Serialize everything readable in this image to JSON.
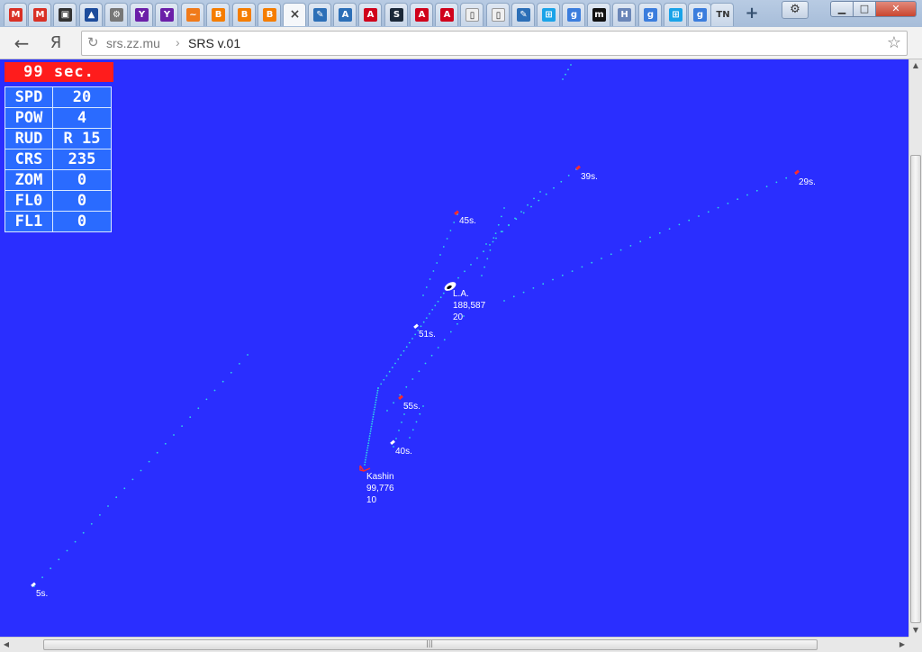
{
  "browser": {
    "tabs": [
      {
        "icon": "gmail-icon",
        "glyph": "M",
        "color": "#d93025"
      },
      {
        "icon": "gmail-icon",
        "glyph": "M",
        "color": "#d93025"
      },
      {
        "icon": "photo-icon",
        "glyph": "▣",
        "color": "#333333"
      },
      {
        "icon": "triangle-logo-icon",
        "glyph": "▲",
        "color": "#1d4c9c"
      },
      {
        "icon": "gear-wrench-icon",
        "glyph": "⚙",
        "color": "#777777"
      },
      {
        "icon": "yahoo-icon",
        "glyph": "Y",
        "color": "#6b1fa8"
      },
      {
        "icon": "yahoo-icon",
        "glyph": "Y",
        "color": "#6b1fa8"
      },
      {
        "icon": "chart-icon",
        "glyph": "~",
        "color": "#f07a1a"
      },
      {
        "icon": "blogger-icon",
        "glyph": "B",
        "color": "#f57d00"
      },
      {
        "icon": "blogger-icon",
        "glyph": "B",
        "color": "#f57d00"
      },
      {
        "icon": "blogger-icon",
        "glyph": "B",
        "color": "#f57d00"
      },
      {
        "icon": "close-icon",
        "glyph": "×",
        "color": "#f5f7fa",
        "active": true
      },
      {
        "icon": "pen-icon",
        "glyph": "✎",
        "color": "#2c6fb7"
      },
      {
        "icon": "translate-icon",
        "glyph": "A",
        "color": "#2c6fb7"
      },
      {
        "icon": "adobe-icon",
        "glyph": "A",
        "color": "#d0021b"
      },
      {
        "icon": "steam-icon",
        "glyph": "S",
        "color": "#1b2838"
      },
      {
        "icon": "adobe-icon",
        "glyph": "A",
        "color": "#d0021b"
      },
      {
        "icon": "adobe-icon",
        "glyph": "A",
        "color": "#d0021b"
      },
      {
        "icon": "document-icon",
        "glyph": "▯",
        "color": "#f0f0f0"
      },
      {
        "icon": "document-icon",
        "glyph": "▯",
        "color": "#f0f0f0"
      },
      {
        "icon": "pen-icon",
        "glyph": "✎",
        "color": "#2c6fb7"
      },
      {
        "icon": "windows-icon",
        "glyph": "⊞",
        "color": "#1aa3e8"
      },
      {
        "icon": "google-plus-icon",
        "glyph": "g",
        "color": "#3b7ddd"
      },
      {
        "icon": "m-logo-icon",
        "glyph": "m",
        "color": "#111111"
      },
      {
        "icon": "h-logo-icon",
        "glyph": "H",
        "color": "#6a86b8"
      },
      {
        "icon": "google-plus-icon",
        "glyph": "g",
        "color": "#3b7ddd"
      },
      {
        "icon": "windows-icon",
        "glyph": "⊞",
        "color": "#1aa3e8"
      },
      {
        "icon": "google-plus-icon",
        "glyph": "g",
        "color": "#3b7ddd"
      },
      {
        "icon": "tn-text-icon",
        "glyph": "TN",
        "color": "#dbe3ee"
      }
    ],
    "url_host": "srs.zz.mu",
    "url_separator": "›",
    "page_title": "SRS v.01",
    "back_glyph": "←",
    "yandex_glyph": "Я",
    "reload_glyph": "↻",
    "star_glyph": "☆",
    "new_tab_glyph": "+",
    "settings_glyph": "⚙",
    "minimize_glyph": "▁",
    "maximize_glyph": "□",
    "close_glyph": "✕"
  },
  "hud": {
    "timer": "99 sec.",
    "params": [
      {
        "key": "SPD",
        "value": "20"
      },
      {
        "key": "POW",
        "value": "4"
      },
      {
        "key": "RUD",
        "value": "R 15"
      },
      {
        "key": "CRS",
        "value": "235"
      },
      {
        "key": "ZOM",
        "value": "0"
      },
      {
        "key": "FL0",
        "value": "0"
      },
      {
        "key": "FL1",
        "value": "0"
      }
    ]
  },
  "radar": {
    "colors": {
      "background": "#2a2eff",
      "trail": "#31d2e6",
      "target_red": "#ff2a2a",
      "target_white": "#ffffff",
      "label": "#ffffff"
    },
    "contacts": [
      {
        "name": "contact-5s",
        "label": "5s.",
        "kind": "white"
      },
      {
        "name": "contact-29s",
        "label": "29s.",
        "kind": "red"
      },
      {
        "name": "contact-39s",
        "label": "39s.",
        "kind": "red"
      },
      {
        "name": "contact-45s",
        "label": "45s.",
        "kind": "red"
      },
      {
        "name": "contact-51s",
        "label": "51s.",
        "kind": "white"
      },
      {
        "name": "contact-55s",
        "label": "55s.",
        "kind": "red"
      },
      {
        "name": "contact-40s",
        "label": "40s.",
        "kind": "white"
      }
    ],
    "ships": [
      {
        "name": "ship-la",
        "lines": [
          "L.A.",
          "188,587",
          "20"
        ]
      },
      {
        "name": "ship-kashin",
        "lines": [
          "Kashin",
          "99,776",
          "10"
        ]
      }
    ]
  },
  "scrollbars": {
    "up_glyph": "▲",
    "down_glyph": "▼",
    "left_glyph": "◀",
    "right_glyph": "▶",
    "grip_glyph": "|||"
  }
}
